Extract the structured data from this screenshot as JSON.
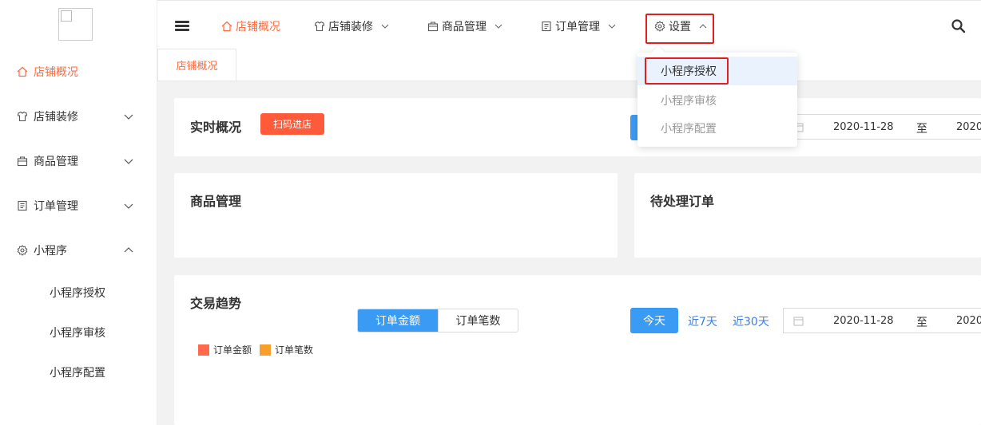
{
  "sidebar": {
    "items": [
      {
        "label": "店铺概况",
        "icon": "home-icon",
        "active": true
      },
      {
        "label": "店铺装修",
        "icon": "palette-icon"
      },
      {
        "label": "商品管理",
        "icon": "box-icon"
      },
      {
        "label": "订单管理",
        "icon": "document-icon"
      },
      {
        "label": "小程序",
        "icon": "gear-icon",
        "expanded": true
      }
    ],
    "subitems": [
      "小程序授权",
      "小程序审核",
      "小程序配置"
    ]
  },
  "topnav": {
    "items": [
      "店铺概况",
      "店铺装修",
      "商品管理",
      "订单管理",
      "设置"
    ]
  },
  "dropdown": {
    "items": [
      "小程序授权",
      "小程序审核",
      "小程序配置"
    ],
    "selected_index": 0
  },
  "tabs": [
    "店铺概况"
  ],
  "realtime": {
    "title": "实时概况",
    "scan_button": "扫码进店",
    "date_from": "2020-11-28",
    "to_label": "至",
    "date_to": "2020-"
  },
  "goods": {
    "title": "商品管理"
  },
  "orders": {
    "title": "待处理订单"
  },
  "trend": {
    "title": "交易趋势",
    "seg_on": "订单金额",
    "seg_off": "订单笔数",
    "today": "今天",
    "last7": "近7天",
    "last30": "近30天",
    "date_from": "2020-11-28",
    "to_label": "至",
    "date_to": "2020-",
    "legend": [
      {
        "label": "订单金额",
        "color": "#ff6a4d"
      },
      {
        "label": "订单笔数",
        "color": "#f79f2a"
      }
    ]
  },
  "colors": {
    "accent": "#ff6a3d",
    "primary": "#3a9bf4",
    "highlight_box": "#e02020"
  }
}
